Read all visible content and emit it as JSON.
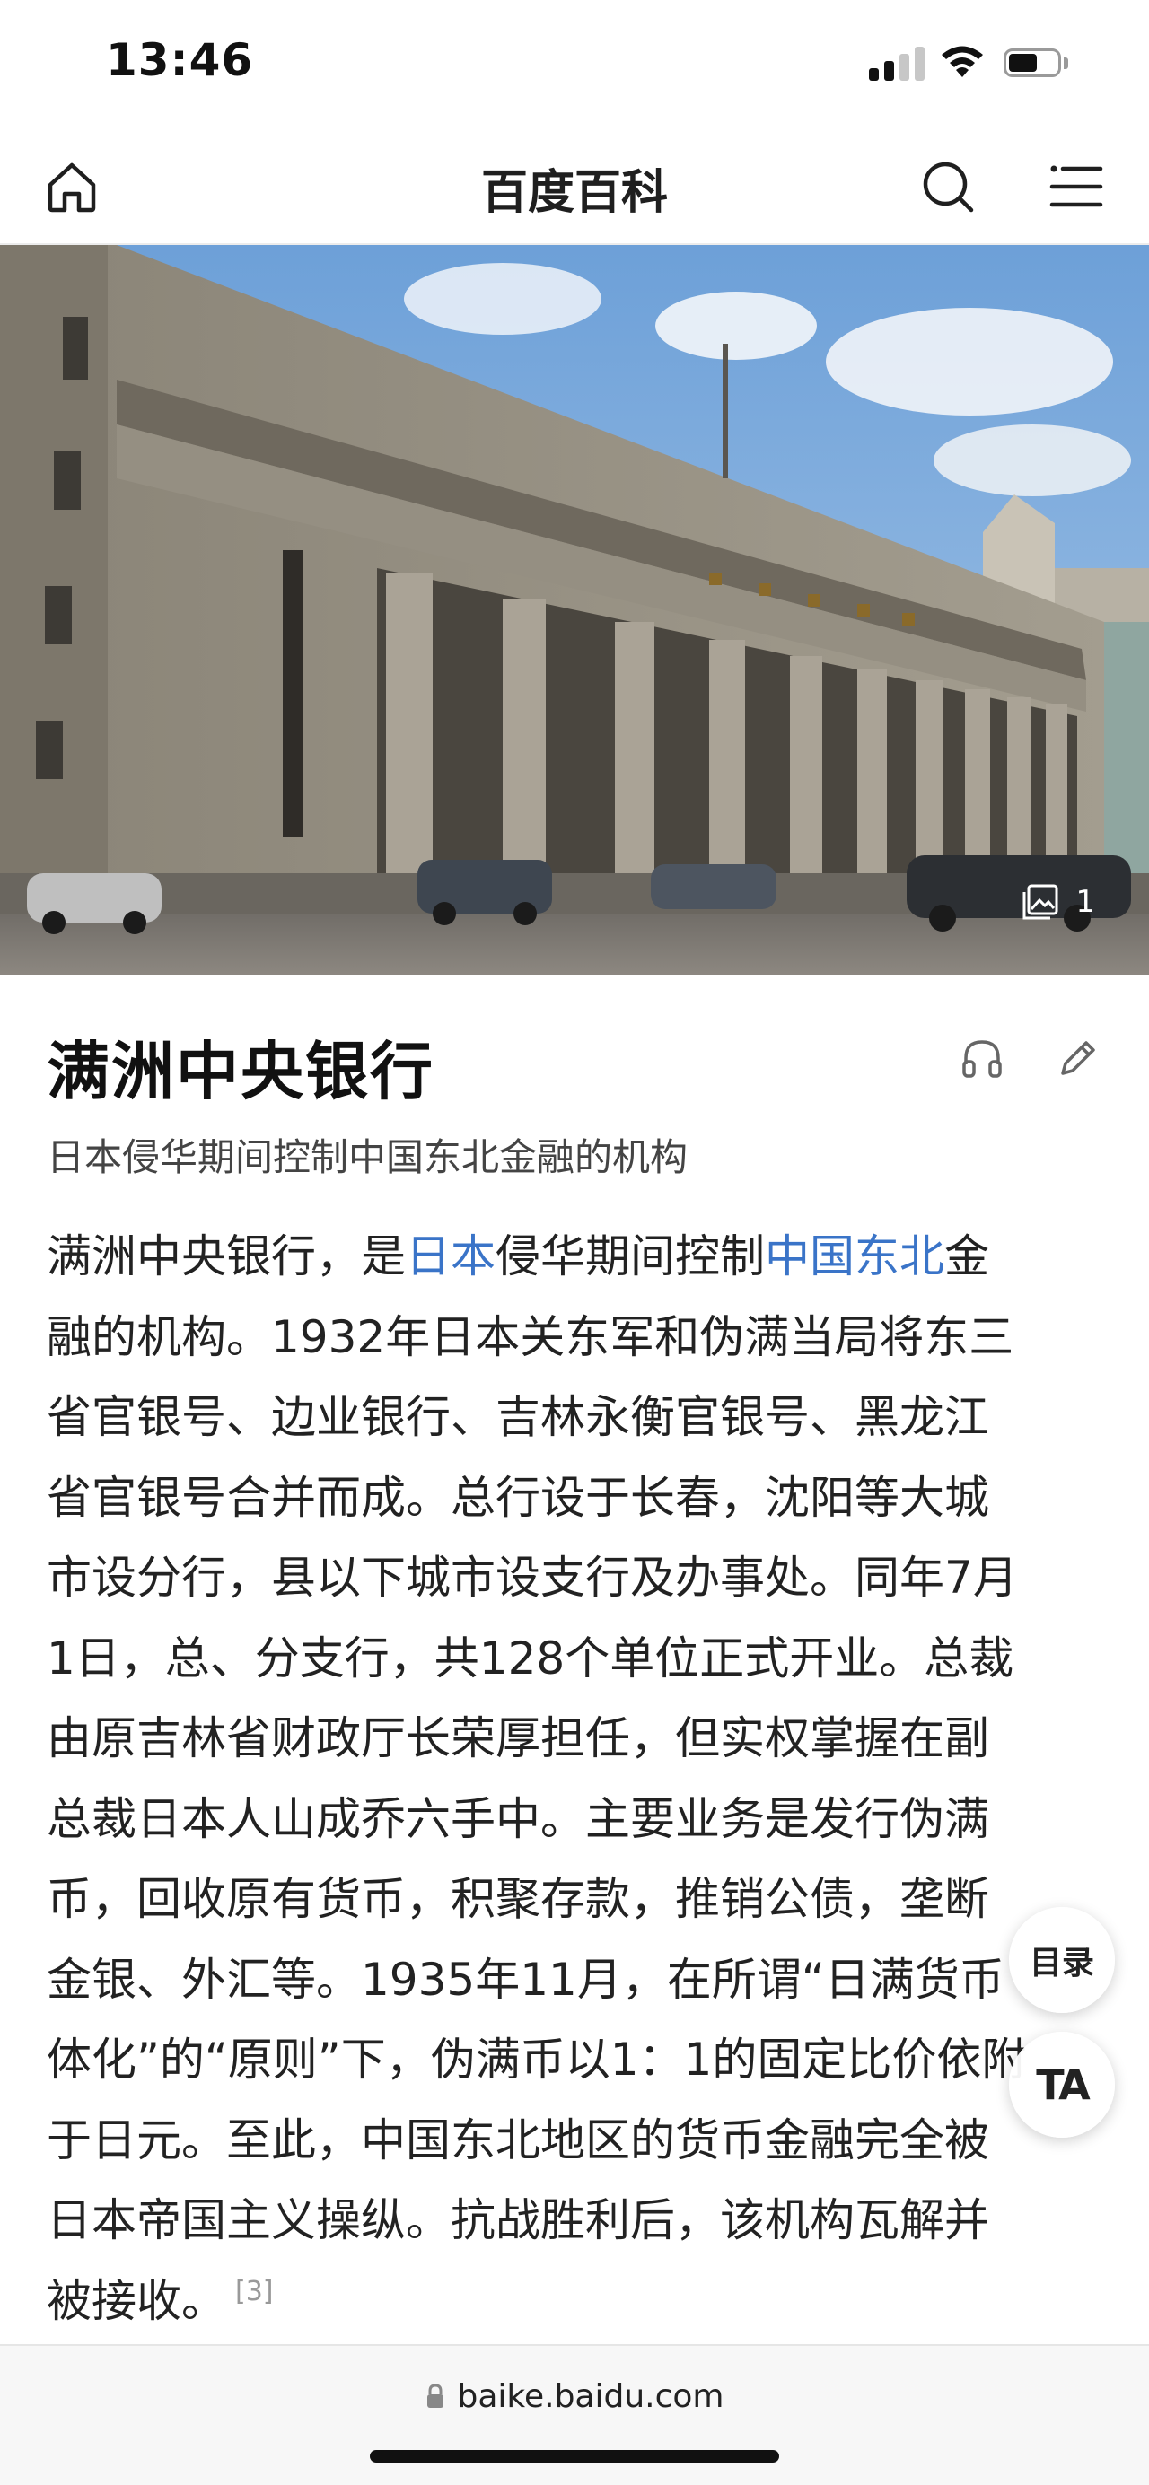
{
  "status_bar": {
    "time": "13:46",
    "signal_icon": "cellular-signal-icon",
    "wifi_icon": "wifi-icon",
    "battery_icon": "battery-icon",
    "battery_level": 0.6
  },
  "nav": {
    "home_icon": "home-icon",
    "title": "百度百科",
    "search_icon": "search-icon",
    "menu_icon": "menu-list-icon"
  },
  "hero": {
    "image_description_icon": "building-photo",
    "gallery_icon": "image-gallery-icon",
    "gallery_count": "1"
  },
  "article": {
    "title": "满洲中央银行",
    "listen_icon": "headphones-icon",
    "edit_icon": "pencil-edit-icon",
    "subtitle": "日本侵华期间控制中国东北金融的机构",
    "body": {
      "l1_a": "满洲中央银行，是",
      "l1_link1": "日本",
      "l1_b": "侵华期间控制",
      "l1_link2": "中国东北",
      "l1_c": "金",
      "l2": "融的机构。1932年日本关东军和伪满当局将东三",
      "l3": "省官银号、边业银行、吉林永衡官银号、黑龙江",
      "l4": "省官银号合并而成。总行设于长春，沈阳等大城",
      "l5": "市设分行，县以下城市设支行及办事处。同年7月",
      "l6": "1日，总、分支行，共128个单位正式开业。总裁",
      "l7": "由原吉林省财政厅长荣厚担任，但实权掌握在副",
      "l8": "总裁日本人山成乔六手中。主要业务是发行伪满",
      "l9": "币，回收原有货币，积聚存款，推销公债，垄断",
      "l10": "金银、外汇等。1935年11月，在所谓“日满货币",
      "l11": "体化”的“原则”下，伪满币以1：1的固定比价依附",
      "l12": "于日元。至此，中国东北地区的货币金融完全被",
      "l13": "日本帝国主义操纵。抗战胜利后，该机构瓦解并",
      "l14": "被接收。",
      "ref": "[3]"
    }
  },
  "floating": {
    "toc_label": "目录",
    "text_size_label": "TA"
  },
  "url_bar": {
    "lock_icon": "lock-icon",
    "url": "baike.baidu.com"
  }
}
